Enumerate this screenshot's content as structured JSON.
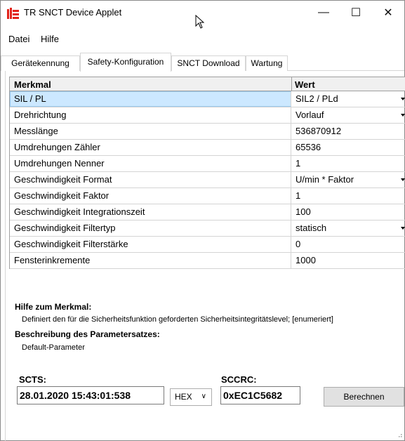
{
  "window": {
    "title": "TR SNCT Device Applet",
    "controls": {
      "minimize": "—",
      "maximize": "☐",
      "close": "✕"
    }
  },
  "menu": {
    "items": [
      "Datei",
      "Hilfe"
    ]
  },
  "tabs": [
    {
      "label": "Gerätekennung",
      "active": false
    },
    {
      "label": "Safety-Konfiguration",
      "active": true
    },
    {
      "label": "SNCT Download",
      "active": false
    },
    {
      "label": "Wartung",
      "active": false
    }
  ],
  "grid": {
    "headers": {
      "key": "Merkmal",
      "value": "Wert"
    },
    "rows": [
      {
        "key": "SIL / PL",
        "value": "SIL2 / PLd",
        "dropdown": true,
        "selected": true
      },
      {
        "key": "Drehrichtung",
        "value": "Vorlauf",
        "dropdown": true,
        "selected": false
      },
      {
        "key": "Messlänge",
        "value": "536870912",
        "dropdown": false,
        "selected": false
      },
      {
        "key": "Umdrehungen Zähler",
        "value": "65536",
        "dropdown": false,
        "selected": false
      },
      {
        "key": "Umdrehungen Nenner",
        "value": "1",
        "dropdown": false,
        "selected": false
      },
      {
        "key": "Geschwindigkeit Format",
        "value": "U/min * Faktor",
        "dropdown": true,
        "selected": false
      },
      {
        "key": "Geschwindigkeit Faktor",
        "value": "1",
        "dropdown": false,
        "selected": false
      },
      {
        "key": "Geschwindigkeit Integrationszeit",
        "value": "100",
        "dropdown": false,
        "selected": false
      },
      {
        "key": "Geschwindigkeit Filtertyp",
        "value": "statisch",
        "dropdown": true,
        "selected": false
      },
      {
        "key": "Geschwindigkeit Filterstärke",
        "value": "0",
        "dropdown": false,
        "selected": false
      },
      {
        "key": "Fensterinkremente",
        "value": "1000",
        "dropdown": false,
        "selected": false
      }
    ]
  },
  "help": {
    "title": "Hilfe zum Merkmal:",
    "text": "Definiert den für die Sicherheitsfunktion geforderten Sicherheitsintegritätslevel; [enumeriert]"
  },
  "description": {
    "title": "Beschreibung des Parametersatzes:",
    "text": "Default-Parameter"
  },
  "footer": {
    "scts_label": "SCTS:",
    "scts_value": "28.01.2020 15:43:01:538",
    "format_selected": "HEX",
    "sccrc_label": "SCCRC:",
    "sccrc_value": "0xEC1C5682",
    "calc_button": "Berechnen"
  }
}
